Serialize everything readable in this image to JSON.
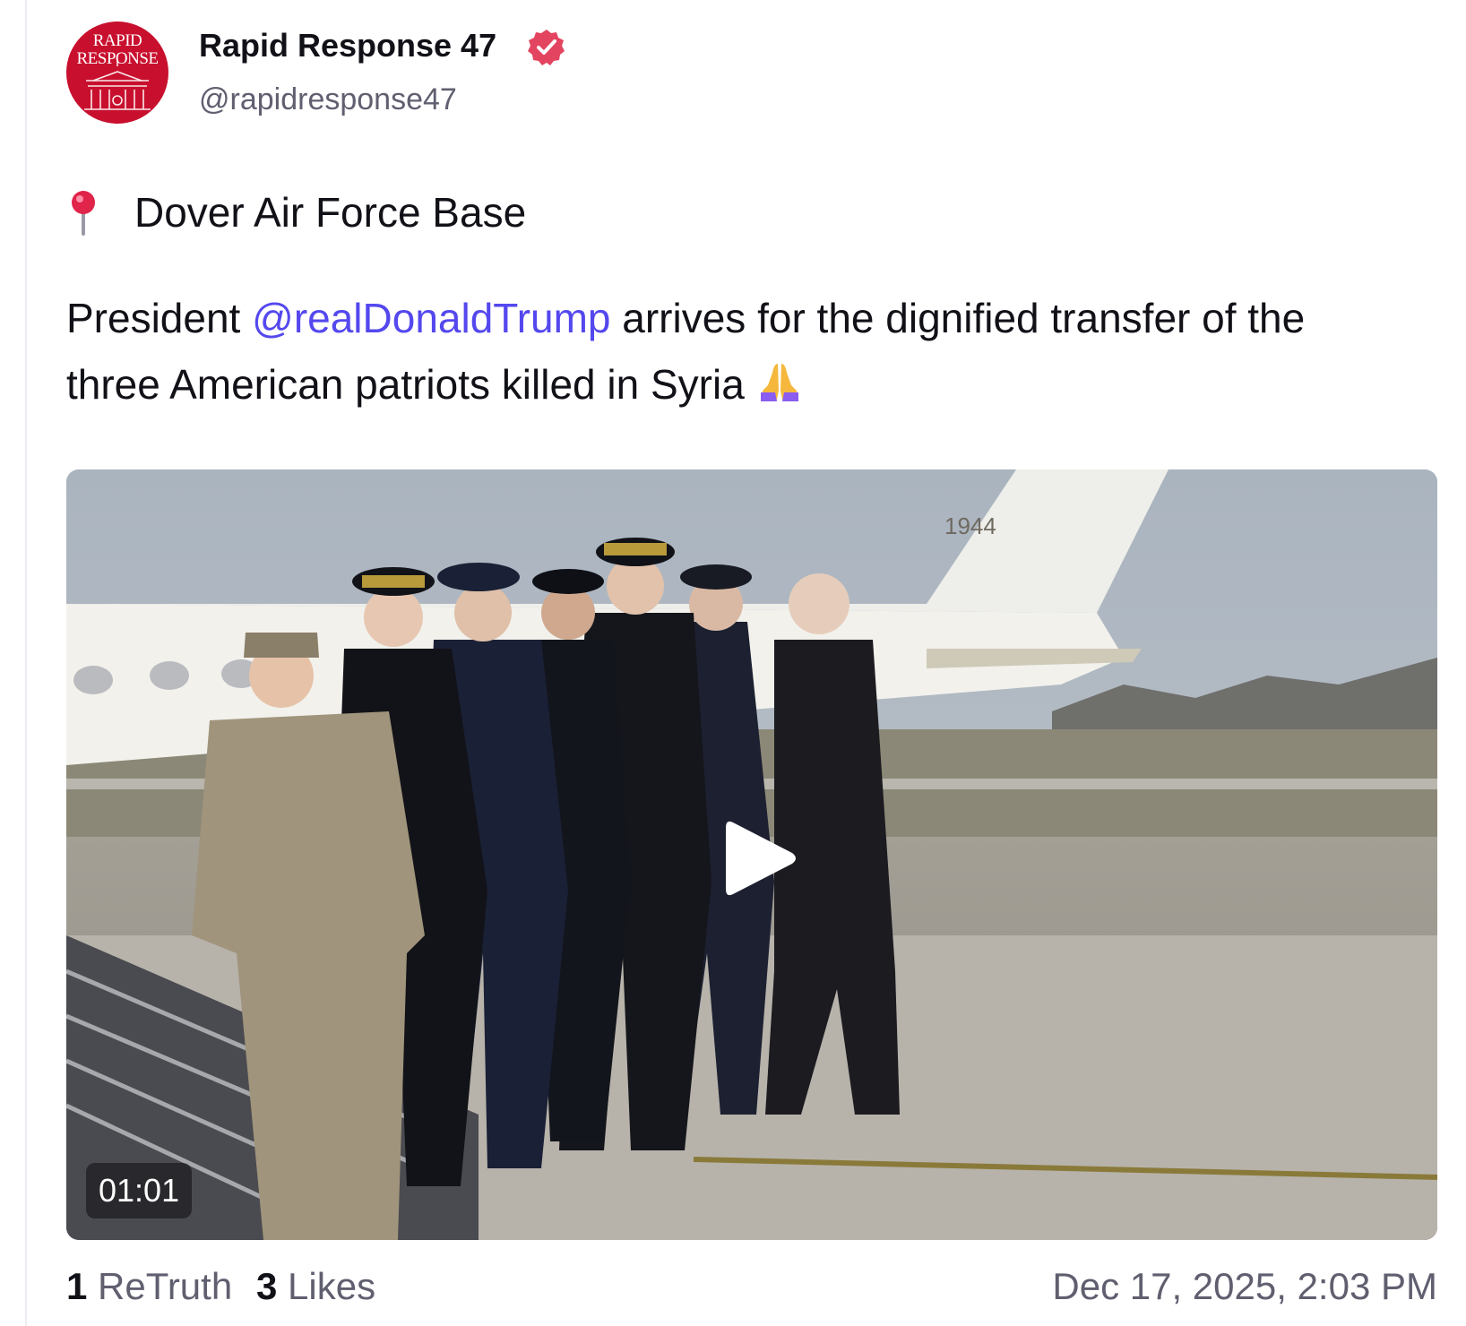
{
  "account": {
    "avatar_line1": "RAPID",
    "avatar_line2": "RESPONSE",
    "display_name": "Rapid Response 47",
    "handle": "@rapidresponse47"
  },
  "post": {
    "location": "Dover Air Force Base",
    "text_before": "President ",
    "mention": "@realDonaldTrump",
    "text_after": " arrives for the dignified transfer of the three American patriots killed in Syria",
    "emoji": "praying-hands"
  },
  "media": {
    "type": "video",
    "duration": "01:01",
    "tail_number": "1944"
  },
  "footer": {
    "retruth_count": "1",
    "retruth_label": "ReTruth",
    "likes_count": "3",
    "likes_label": "Likes",
    "timestamp": "Dec 17, 2025, 2:03 PM"
  },
  "colors": {
    "mention": "#5448ee",
    "verified": "#e3445f",
    "avatar_bg": "#c8102e",
    "muted_text": "#5f5f70"
  }
}
